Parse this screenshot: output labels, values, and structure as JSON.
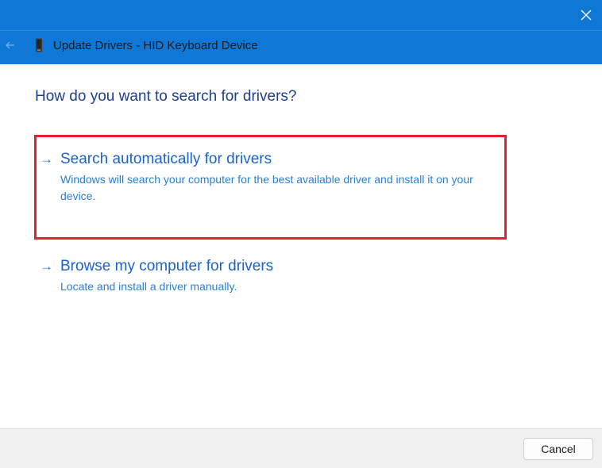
{
  "window": {
    "title": "Update Drivers - HID Keyboard Device",
    "accent_color": "#0f78d7"
  },
  "icons": {
    "close": "close-icon",
    "back": "back-arrow-icon",
    "device": "device-icon",
    "option_arrow": "arrow-right-icon"
  },
  "question": "How do you want to search for drivers?",
  "options": [
    {
      "title": "Search automatically for drivers",
      "description": "Windows will search your computer for the best available driver and install it on your device.",
      "highlighted": true,
      "highlight_color": "#e8202a"
    },
    {
      "title": "Browse my computer for drivers",
      "description": "Locate and install a driver manually.",
      "highlighted": false
    }
  ],
  "footer": {
    "cancel_label": "Cancel"
  }
}
